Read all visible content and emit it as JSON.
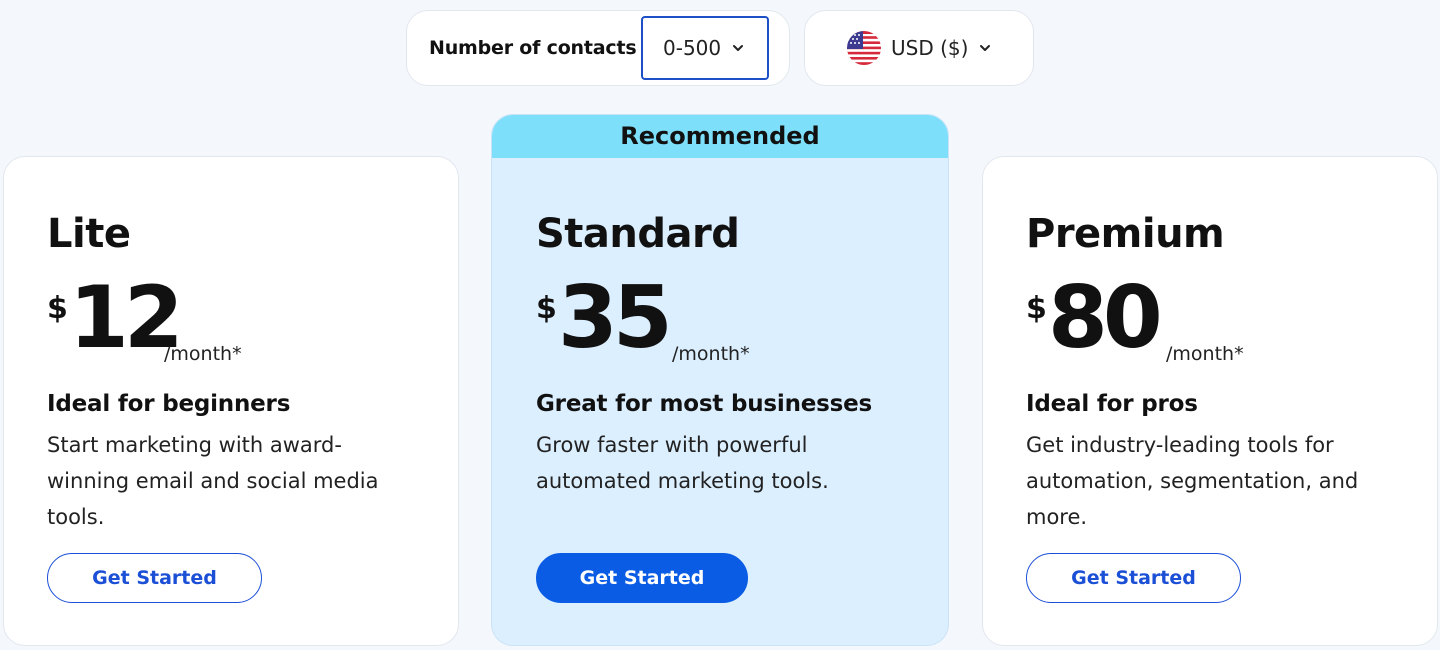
{
  "controls": {
    "contacts_label": "Number of contacts",
    "contacts_value": "0-500",
    "currency_value": "USD ($)"
  },
  "recommended_label": "Recommended",
  "plans": [
    {
      "name": "Lite",
      "currency": "$",
      "amount": "12",
      "period": "/month*",
      "tagline": "Ideal for beginners",
      "description": "Start marketing with award-winning email and social media tools.",
      "button": "Get Started"
    },
    {
      "name": "Standard",
      "currency": "$",
      "amount": "35",
      "period": "/month*",
      "tagline": "Great for most businesses",
      "description": "Grow faster with powerful automated marketing tools.",
      "button": "Get Started"
    },
    {
      "name": "Premium",
      "currency": "$",
      "amount": "80",
      "period": "/month*",
      "tagline": "Ideal for pros",
      "description": "Get industry-leading tools for automation, segmentation, and more.",
      "button": "Get Started"
    }
  ],
  "colors": {
    "accent_blue": "#0b5ce5",
    "recommended_banner": "#7ddffa",
    "recommended_card": "#dcefff"
  },
  "icons": {
    "flag": "us-flag-icon",
    "dropdown": "chevron-down-icon"
  }
}
